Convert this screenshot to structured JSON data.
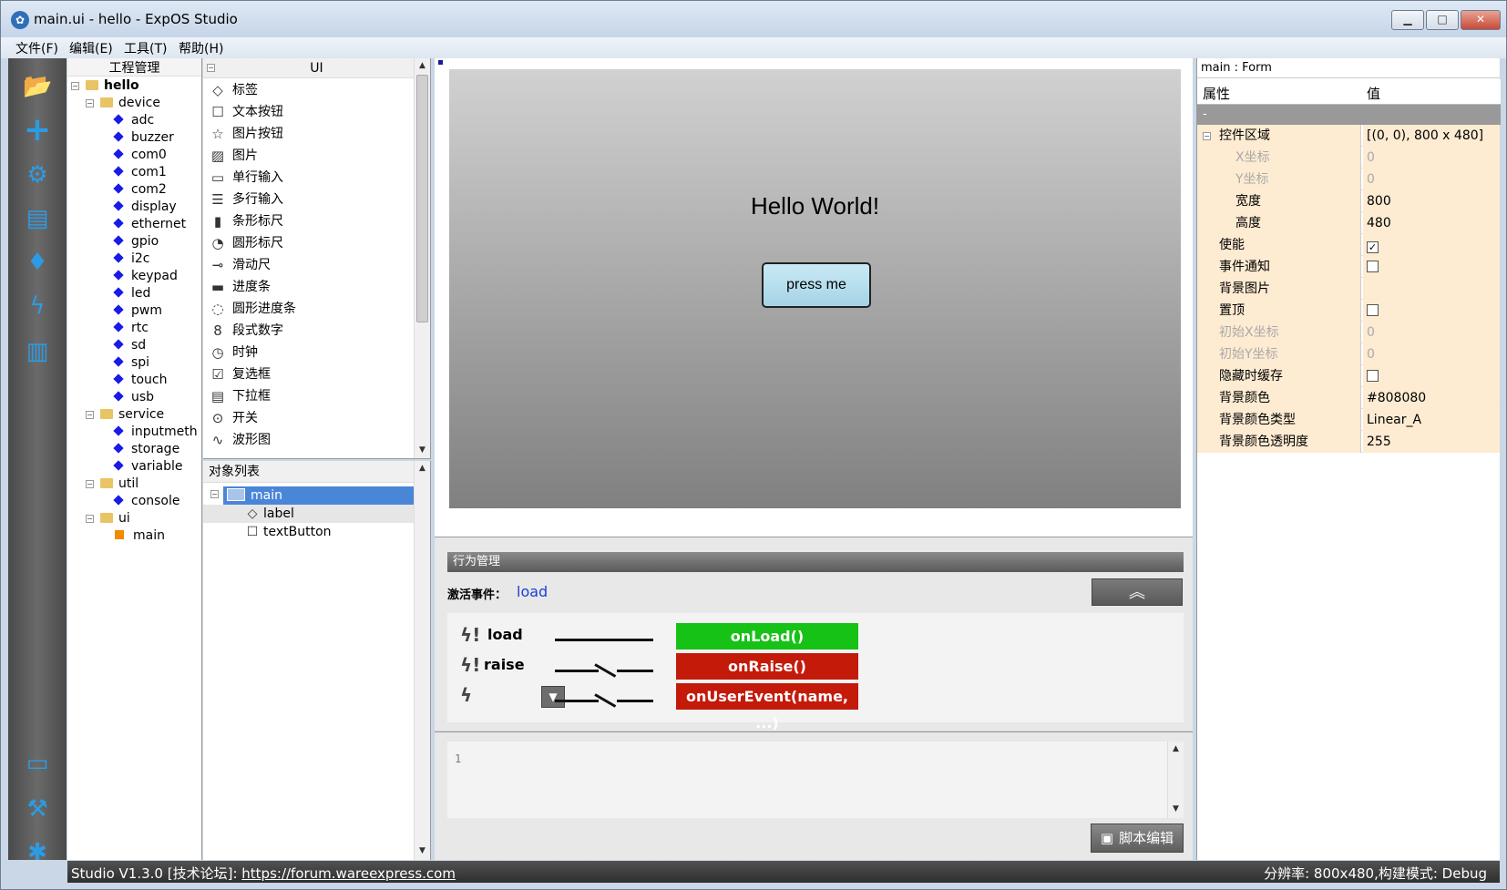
{
  "window": {
    "title": "main.ui - hello - ExpOS Studio",
    "app_icon": "app-logo-icon"
  },
  "menu": [
    "文件(F)",
    "编辑(E)",
    "工具(T)",
    "帮助(H)"
  ],
  "project": {
    "title": "工程管理",
    "root": "hello",
    "folders": {
      "device": {
        "label": "device",
        "items": [
          "adc",
          "buzzer",
          "com0",
          "com1",
          "com2",
          "display",
          "ethernet",
          "gpio",
          "i2c",
          "keypad",
          "led",
          "pwm",
          "rtc",
          "sd",
          "spi",
          "touch",
          "usb"
        ]
      },
      "service": {
        "label": "service",
        "items": [
          "inputmeth",
          "storage",
          "variable"
        ]
      },
      "util": {
        "label": "util",
        "items": [
          "console"
        ]
      },
      "ui": {
        "label": "ui",
        "items": [
          "main"
        ]
      }
    }
  },
  "ui_palette": {
    "title": "UI",
    "items": [
      "标签",
      "文本按钮",
      "图片按钮",
      "图片",
      "单行输入",
      "多行输入",
      "条形标尺",
      "圆形标尺",
      "滑动尺",
      "进度条",
      "圆形进度条",
      "段式数字",
      "时钟",
      "复选框",
      "下拉框",
      "开关",
      "波形图"
    ]
  },
  "object_list": {
    "title": "对象列表",
    "root": "main",
    "children": [
      "label",
      "textButton"
    ]
  },
  "form": {
    "label_text": "Hello World!",
    "button_text": "press me"
  },
  "behavior": {
    "title": "行为管理",
    "active_event_label": "激活事件：",
    "active_event_value": "load",
    "events": [
      {
        "name": "load",
        "handler": "onLoad()",
        "color": "#17c217"
      },
      {
        "name": "raise",
        "handler": "onRaise()",
        "color": "#c41a0a"
      },
      {
        "name": "",
        "handler": "onUserEvent(name, ...)",
        "color": "#c41a0a"
      }
    ]
  },
  "script": {
    "line_number": "1",
    "button": "脚本编辑"
  },
  "properties": {
    "title": "main : Form",
    "col_key": "属性",
    "col_value": "值",
    "section": "-",
    "rows": [
      {
        "key": "控件区域",
        "value": "[(0, 0), 800 x 480]",
        "indent": 0
      },
      {
        "key": "X坐标",
        "value": "0",
        "indent": 1
      },
      {
        "key": "Y坐标",
        "value": "0",
        "indent": 1
      },
      {
        "key": "宽度",
        "value": "800",
        "indent": 1
      },
      {
        "key": "高度",
        "value": "480",
        "indent": 1
      },
      {
        "key": "使能",
        "value": "",
        "indent": 0
      },
      {
        "key": "事件通知",
        "value": "",
        "indent": 0
      },
      {
        "key": "背景图片",
        "value": "",
        "indent": 0
      },
      {
        "key": "置顶",
        "value": "",
        "indent": 0
      },
      {
        "key": "初始X坐标",
        "value": "0",
        "indent": 0
      },
      {
        "key": "初始Y坐标",
        "value": "0",
        "indent": 0
      },
      {
        "key": "隐藏时缓存",
        "value": "",
        "indent": 0
      },
      {
        "key": "背景颜色",
        "value": "#808080",
        "indent": 0
      },
      {
        "key": "背景颜色类型",
        "value": "Linear_A",
        "indent": 0
      },
      {
        "key": "背景颜色透明度",
        "value": "255",
        "indent": 0
      }
    ]
  },
  "status": {
    "left_text": "Studio V1.3.0 [技术论坛]: ",
    "link": "https://forum.wareexpress.com",
    "right_text": "分辨率: 800x480,构建模式: Debug"
  },
  "colors": {
    "accent": "#2c9be6",
    "handler_green": "#17c217",
    "handler_red": "#c41a0a"
  }
}
